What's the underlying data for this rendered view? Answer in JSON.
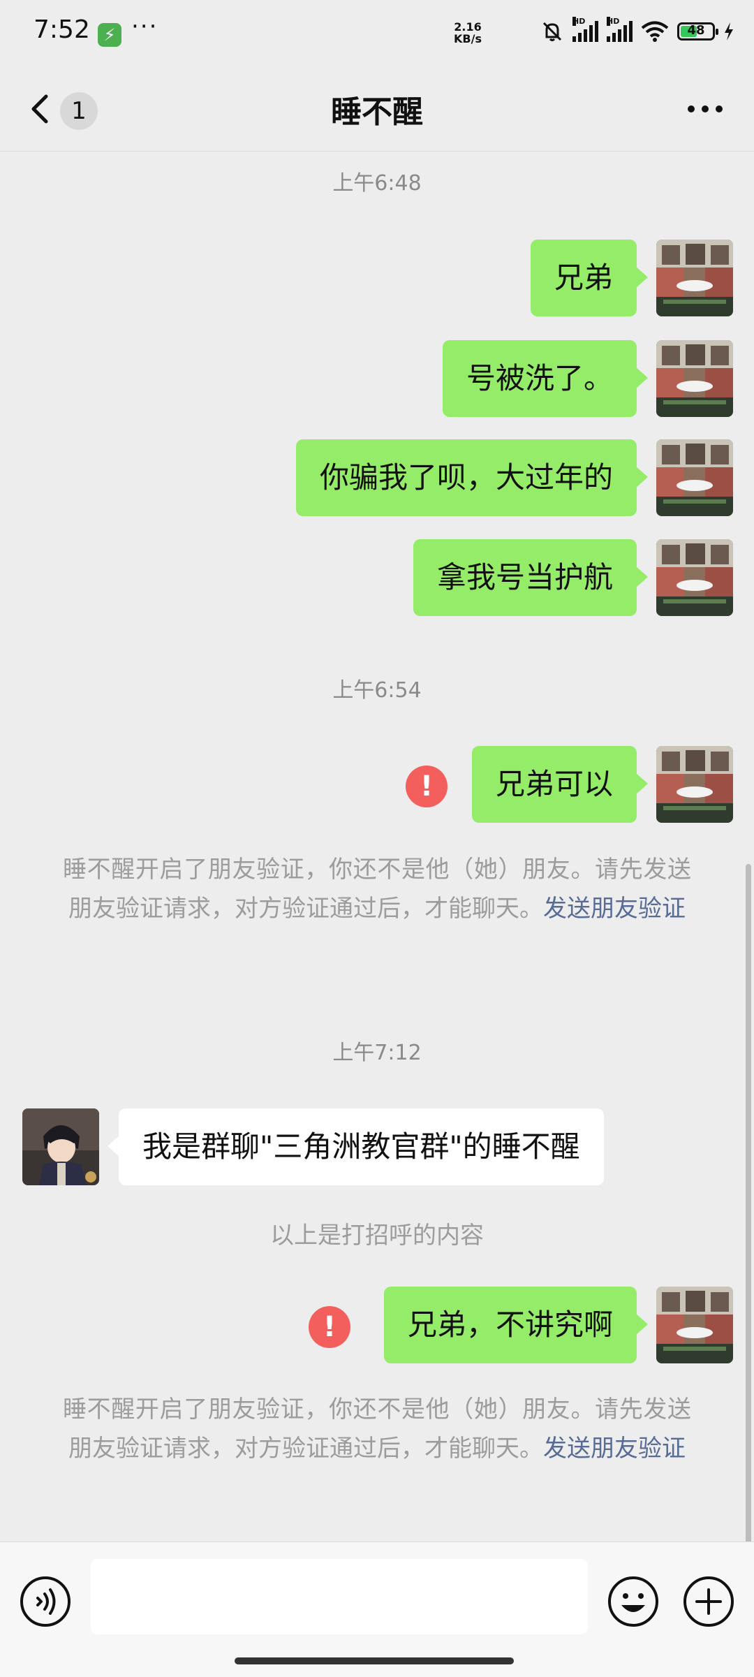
{
  "status_bar": {
    "time": "7:52",
    "app_icon": "charging-bolt-icon",
    "more": "···",
    "net_speed_value": "2.16",
    "net_speed_unit": "KB/s",
    "battery": "48",
    "icons": [
      "mute-bell-icon",
      "hd-signal-icon",
      "hd-signal-icon",
      "wifi-icon",
      "battery-icon",
      "charging-icon"
    ]
  },
  "header": {
    "unread_count": "1",
    "title": "睡不醒"
  },
  "messages": {
    "ts1": "上午6:48",
    "m1": "兄弟",
    "m2": "号被洗了。",
    "m3": "你骗我了呗，大过年的",
    "m4": "拿我号当护航",
    "ts2": "上午6:54",
    "m5": "兄弟可以",
    "sys1_text": "睡不醒开启了朋友验证，你还不是他（她）朋友。请先发送朋友验证请求，对方验证通过后，才能聊天。",
    "sys1_link": "发送朋友验证",
    "ts3": "上午7:12",
    "m6": "我是群聊\"三角洲教官群\"的睡不醒",
    "greet_note": "以上是打招呼的内容",
    "m7": "兄弟，不讲究啊",
    "sys2_text": "睡不醒开启了朋友验证，你还不是他（她）朋友。请先发送朋友验证请求，对方验证通过后，才能聊天。",
    "sys2_link": "发送朋友验证"
  },
  "error_mark": "!",
  "colors": {
    "background": "#ededed",
    "outgoing_bubble": "#95ec69",
    "incoming_bubble": "#ffffff",
    "error": "#f25f5c",
    "link": "#576b95"
  },
  "input_bar": {
    "value": "",
    "icons": [
      "voice-icon",
      "emoji-icon",
      "plus-icon"
    ]
  }
}
